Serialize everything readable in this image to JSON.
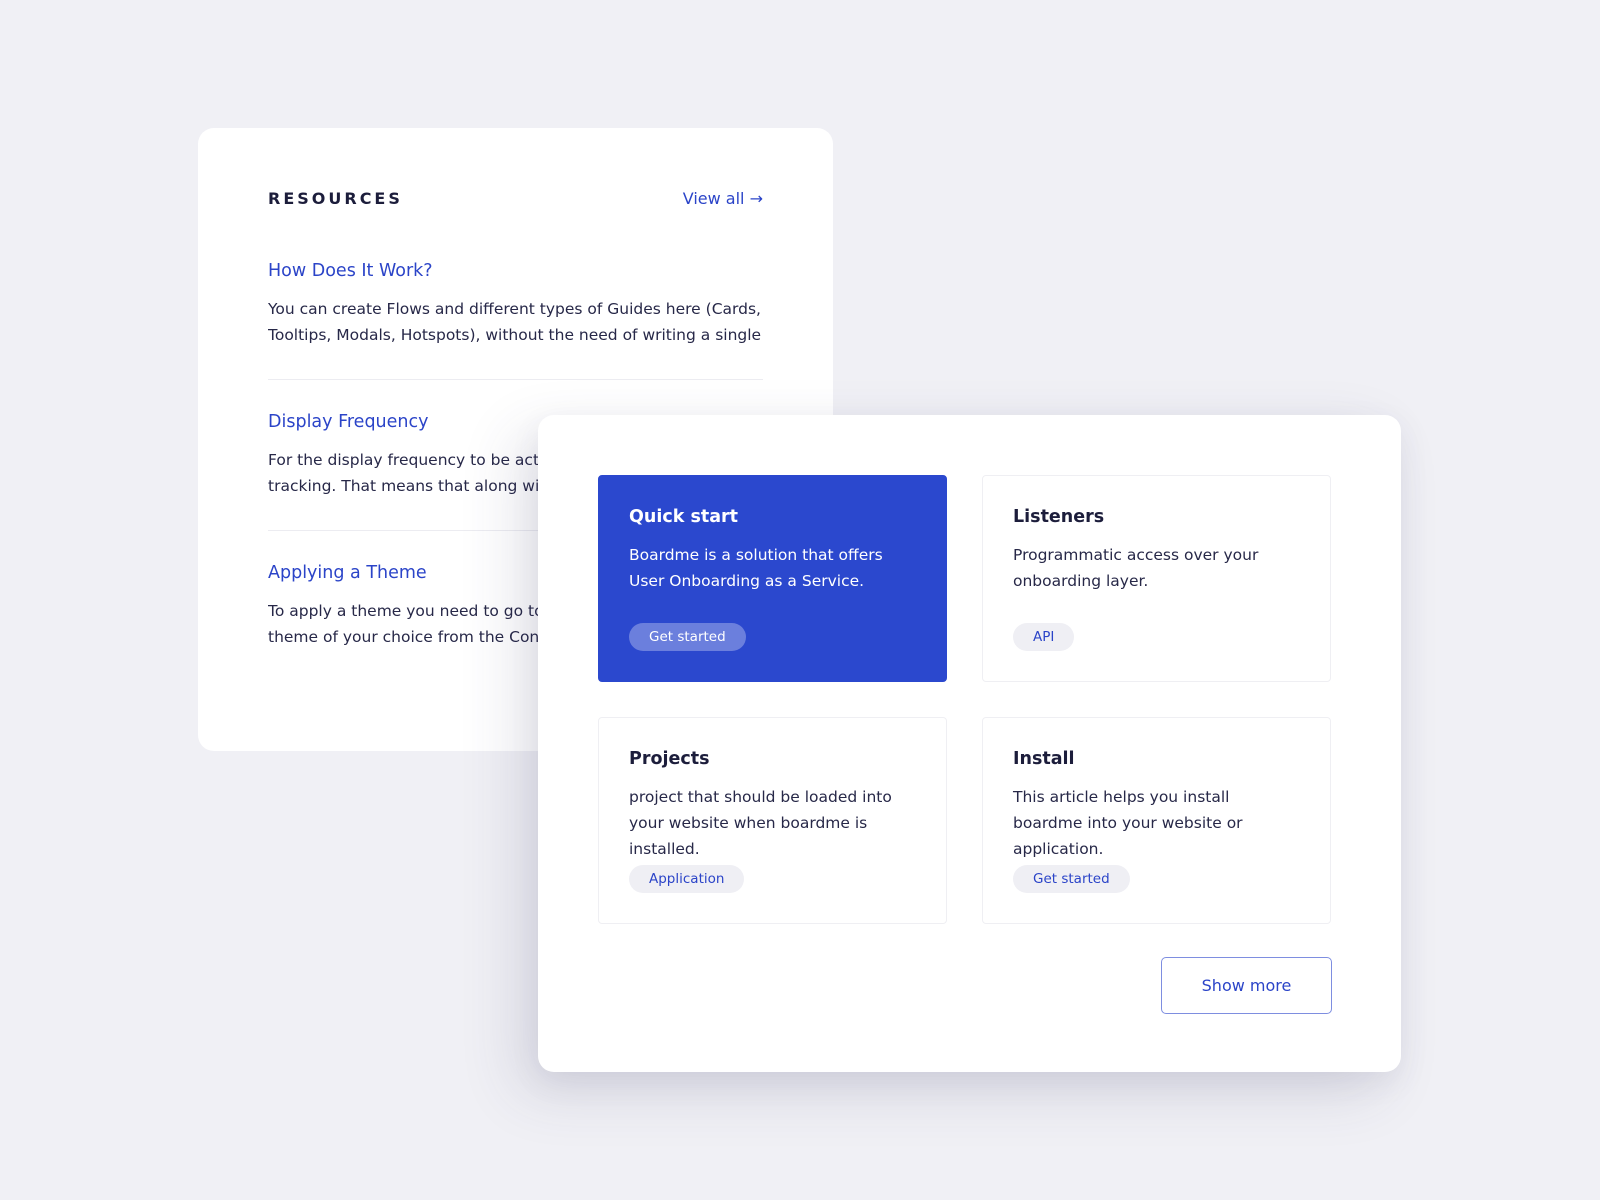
{
  "resources": {
    "title": "RESOURCES",
    "view_all": "View all →",
    "items": [
      {
        "title": "How Does It Work?",
        "lines": [
          "You can create Flows and different types of Guides here (Cards,",
          "Tooltips, Modals, Hotspots), without the need of writing a single ..."
        ]
      },
      {
        "title": "Display Frequency",
        "lines": [
          "For the display frequency to be activa",
          "tracking. That means that along with y"
        ]
      },
      {
        "title": "Applying a Theme",
        "lines": [
          "To apply a theme you need to go to th",
          "theme of your choice from the Control"
        ]
      }
    ]
  },
  "panel": {
    "cards": [
      {
        "title": "Quick start",
        "text": "Boardme is a solution that offers User Onboarding as a Service.",
        "tag": "Get started",
        "active": true
      },
      {
        "title": "Listeners",
        "text": "Programmatic access over your onboarding layer.",
        "tag": "API",
        "active": false
      },
      {
        "title": "Projects",
        "text": "project that should be loaded into your website when boardme is installed.",
        "tag": "Application",
        "active": false
      },
      {
        "title": "Install",
        "text": "This article helps you install boardme into your website or application.",
        "tag": "Get started",
        "active": false
      }
    ],
    "show_more": "Show more"
  },
  "colors": {
    "accent": "#2b48ce",
    "link": "#2b44c8",
    "background": "#f0f0f5",
    "text": "#1c1d3b"
  }
}
